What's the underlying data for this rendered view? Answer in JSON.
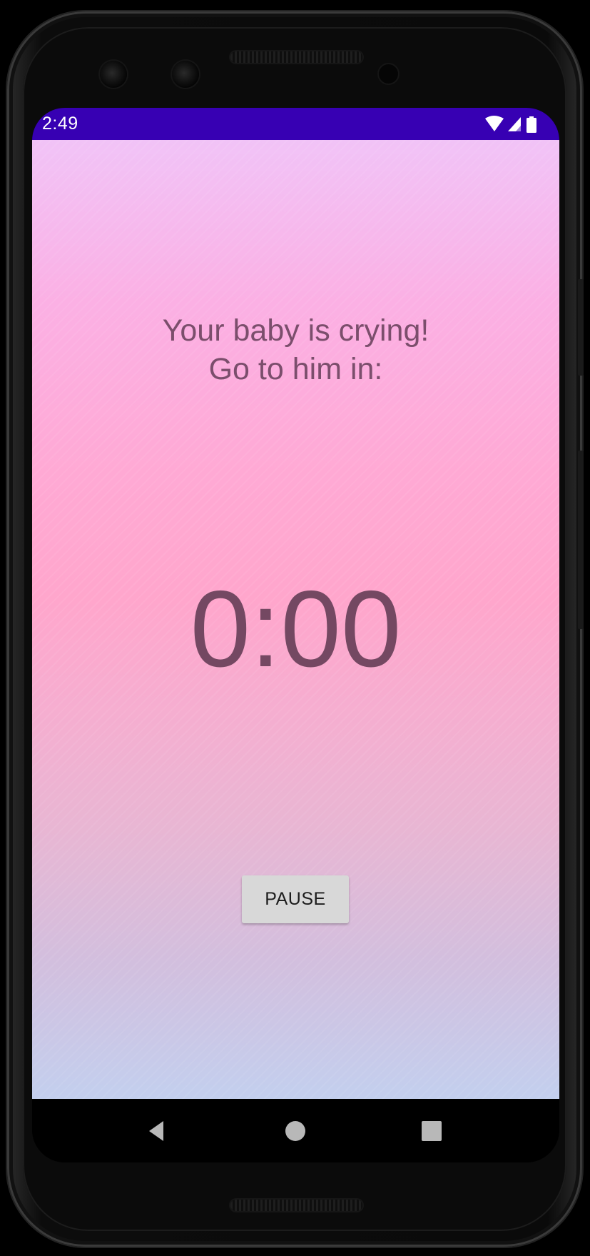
{
  "status_bar": {
    "time": "2:49",
    "icons": [
      "wifi-icon",
      "cellular-signal-icon",
      "battery-icon"
    ],
    "color": "#3700b3"
  },
  "main": {
    "message_line1": "Your baby is crying!",
    "message_line2": "Go to him in:",
    "timer": "0:00",
    "pause_label": "PAUSE"
  },
  "nav_bar": {
    "icons": [
      "back-icon",
      "home-icon",
      "recents-icon"
    ]
  }
}
